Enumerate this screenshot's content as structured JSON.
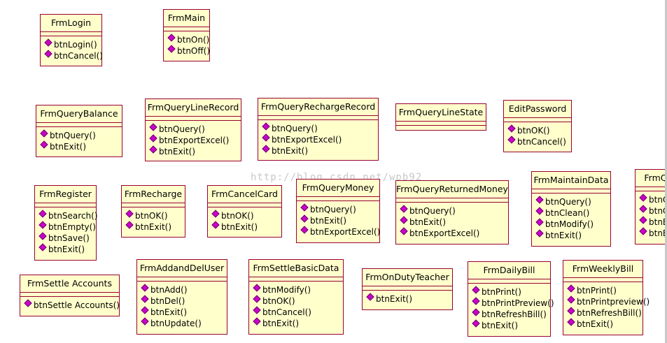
{
  "watermark": "http://blog.csdn.net/wpb92",
  "classes": [
    {
      "name": "FrmLogin",
      "ops": [
        "btnLogin()",
        "btnCancel()"
      ]
    },
    {
      "name": "FrmMain",
      "ops": [
        "btnOn()",
        "btnOff()"
      ]
    },
    {
      "name": "FrmQueryBalance",
      "ops": [
        "btnQuery()",
        "btnExit()"
      ]
    },
    {
      "name": "FrmQueryLineRecord",
      "ops": [
        "btnQuery()",
        "btnExportExcel()",
        "btnExit()"
      ]
    },
    {
      "name": "FrmQueryRechargeRecord",
      "ops": [
        "btnQuery()",
        "btnExportExcel()",
        "btnExit()"
      ]
    },
    {
      "name": "FrmQueryLineState",
      "ops": []
    },
    {
      "name": "EditPassword",
      "ops": [
        "btnOK()",
        "btnCancel()"
      ]
    },
    {
      "name": "FrmRegister",
      "ops": [
        "btnSearch()",
        "btnEmpty()",
        "btnSave()",
        "btnExit()"
      ]
    },
    {
      "name": "FrmRecharge",
      "ops": [
        "btnOK()",
        "btnExit()"
      ]
    },
    {
      "name": "FrmCancelCard",
      "ops": [
        "btnOK()",
        "btnExit()"
      ]
    },
    {
      "name": "FrmQueryMoney",
      "ops": [
        "btnQuery()",
        "btnExit()",
        "btnExportExcel()"
      ]
    },
    {
      "name": "FrmQueryReturnedMoney",
      "ops": [
        "btnQuery()",
        "btnExit()",
        "btnExportExcel()"
      ]
    },
    {
      "name": "FrmMaintainData",
      "ops": [
        "btnQuery()",
        "btnClean()",
        "btnModify()",
        "btnExit()"
      ]
    },
    {
      "name": "FrmQ",
      "ops": [
        "btnQ",
        "btnC",
        "btnE",
        "btnE"
      ]
    },
    {
      "name": "FrmSettle Accounts",
      "ops": [
        "btnSettle Accounts()"
      ]
    },
    {
      "name": "FrmAddandDelUser",
      "ops": [
        "btnAdd()",
        "btnDel()",
        "btnExit()",
        "btnUpdate()"
      ]
    },
    {
      "name": "FrmSettleBasicData",
      "ops": [
        "btnModify()",
        "btnOK()",
        "btnCancel()",
        "btnExit()"
      ]
    },
    {
      "name": "FrmOnDutyTeacher",
      "ops": [
        "btnExit()"
      ]
    },
    {
      "name": "FrmDailyBill",
      "ops": [
        "btnPrint()",
        "btnPrintPreview()",
        "btnRefreshBill()",
        "btnExit()"
      ]
    },
    {
      "name": "FrmWeeklyBill",
      "ops": [
        "btnPrint()",
        "btnPrintpreview()",
        "btnRefreshBill()",
        "btnExit()"
      ]
    }
  ]
}
